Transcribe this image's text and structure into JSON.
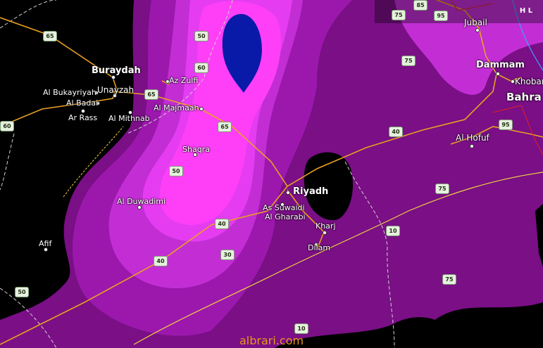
{
  "map": {
    "colors": {
      "background": "#000000",
      "outer": "#7a0f86",
      "mid": "#9c18ad",
      "light": "#c22ed4",
      "lighter": "#e53cf2",
      "brightest": "#ff3ff8",
      "core": "#0a1aa8",
      "road": "#e8a020",
      "border": "#d0d0d0",
      "isoline": "#f2d040",
      "water": "#3ea0ff",
      "region_border": "#e02020"
    },
    "cities": [
      {
        "name": "Buraydah",
        "style": "big"
      },
      {
        "name": "Unayzah",
        "style": "big"
      },
      {
        "name": "Al Bukayriyah",
        "style": "normal"
      },
      {
        "name": "Al Badai",
        "style": "normal"
      },
      {
        "name": "Ar Rass",
        "style": "normal"
      },
      {
        "name": "Al Mithnab",
        "style": "normal"
      },
      {
        "name": "Az Zulfi",
        "style": "normal"
      },
      {
        "name": "Al Majmaah",
        "style": "normal"
      },
      {
        "name": "Shaqra",
        "style": "normal"
      },
      {
        "name": "Al Duwadimi",
        "style": "normal"
      },
      {
        "name": "Riyadh",
        "style": "big"
      },
      {
        "name": "As Suwaidi",
        "style": "normal"
      },
      {
        "name": "Al Gharabi",
        "style": "normal"
      },
      {
        "name": "Kharj",
        "style": "normal"
      },
      {
        "name": "Dilam",
        "style": "normal"
      },
      {
        "name": "Afif",
        "style": "normal"
      },
      {
        "name": "Jubail",
        "style": "normal"
      },
      {
        "name": "Dammam",
        "style": "big"
      },
      {
        "name": "Khobar",
        "style": "normal"
      },
      {
        "name": "Bahra",
        "style": "huge"
      },
      {
        "name": "Al Hofuf",
        "style": "big"
      }
    ],
    "shields": [
      "65",
      "50",
      "60",
      "65",
      "65",
      "60",
      "50",
      "40",
      "40",
      "30",
      "50",
      "10",
      "10",
      "75",
      "75",
      "40",
      "75",
      "95",
      "75",
      "85",
      "95"
    ],
    "layer_control_icon": "layers-icon",
    "layer_control_label": "H L",
    "watermark": "albrari.com"
  }
}
